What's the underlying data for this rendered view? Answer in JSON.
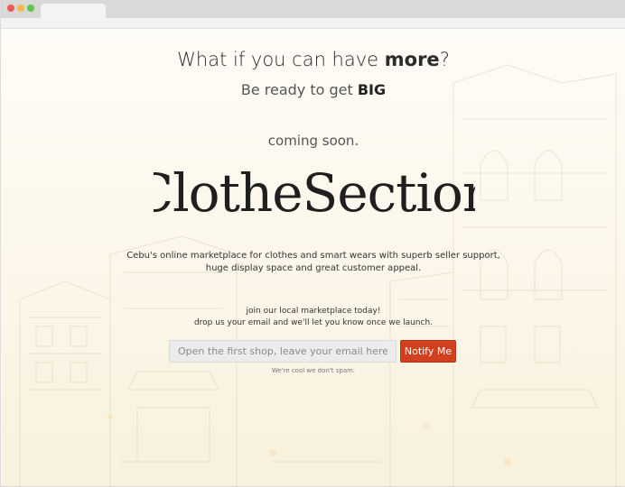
{
  "hero": {
    "headline_pre": "What if you can have ",
    "headline_emph": "more",
    "headline_post": "?",
    "sub_pre": "Be ready to get ",
    "sub_emph": "BIG",
    "coming_soon": "coming soon.",
    "logo_text": "ClotheSection"
  },
  "description": {
    "line1": "Cebu's online marketplace for clothes and smart wears with superb seller support,",
    "line2": "huge display space and great customer appeal."
  },
  "signup": {
    "line1": "join our local marketplace today!",
    "line2": "drop us your email and we'll let you know once we launch.",
    "email_placeholder": "Open the first shop, leave your email here.",
    "email_value": "",
    "button_label": "Notify Me",
    "spam_note": "We're cool we don't spam."
  },
  "colors": {
    "accent": "#d2401f",
    "page_bg": "#fdfaf3",
    "text": "#2b2b2b"
  }
}
